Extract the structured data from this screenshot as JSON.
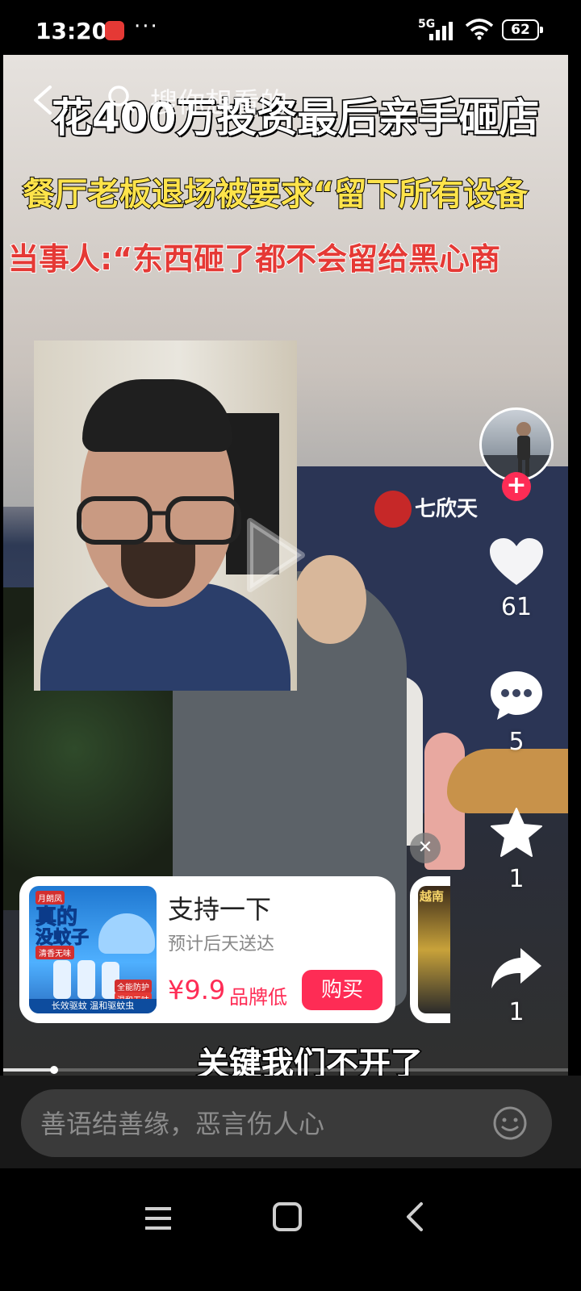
{
  "status_bar": {
    "time": "13:20",
    "more": "···",
    "network": "5G",
    "battery": "62"
  },
  "search": {
    "placeholder": "搜你想看的"
  },
  "video": {
    "headline_1": "花400万投资最后亲手砸店",
    "headline_2": "餐厅老板退场被要求“留下所有设备",
    "headline_3": "当事人:“东西砸了都不会留给黑心商",
    "store_sign": "七欣天",
    "subtitle": "关键我们不开了",
    "progress_fraction": 0.09
  },
  "actions": {
    "likes": "61",
    "comments": "5",
    "favorites": "1",
    "shares": "1",
    "follow_symbol": "+"
  },
  "product": {
    "close_symbol": "✕",
    "image_badge": "月朗凤",
    "image_line1": "真的",
    "image_line2": "没蚊子",
    "image_tag1": "清香无味",
    "image_tag2": "全能防护",
    "image_tag3": "温和无味",
    "image_footer": "长效驱蚊 温和驱蚊虫",
    "title": "支持一下",
    "delivery": "预计后天送达",
    "price": "¥9.9",
    "price_note": "品牌低",
    "buy_label": "购买"
  },
  "product_2": {
    "image_text": "越南"
  },
  "comment_bar": {
    "placeholder": "善语结善缘，恶言伤人心"
  },
  "colors": {
    "accent": "#fe2c55",
    "headline_yellow": "#fde34a",
    "headline_red": "#e53935"
  }
}
